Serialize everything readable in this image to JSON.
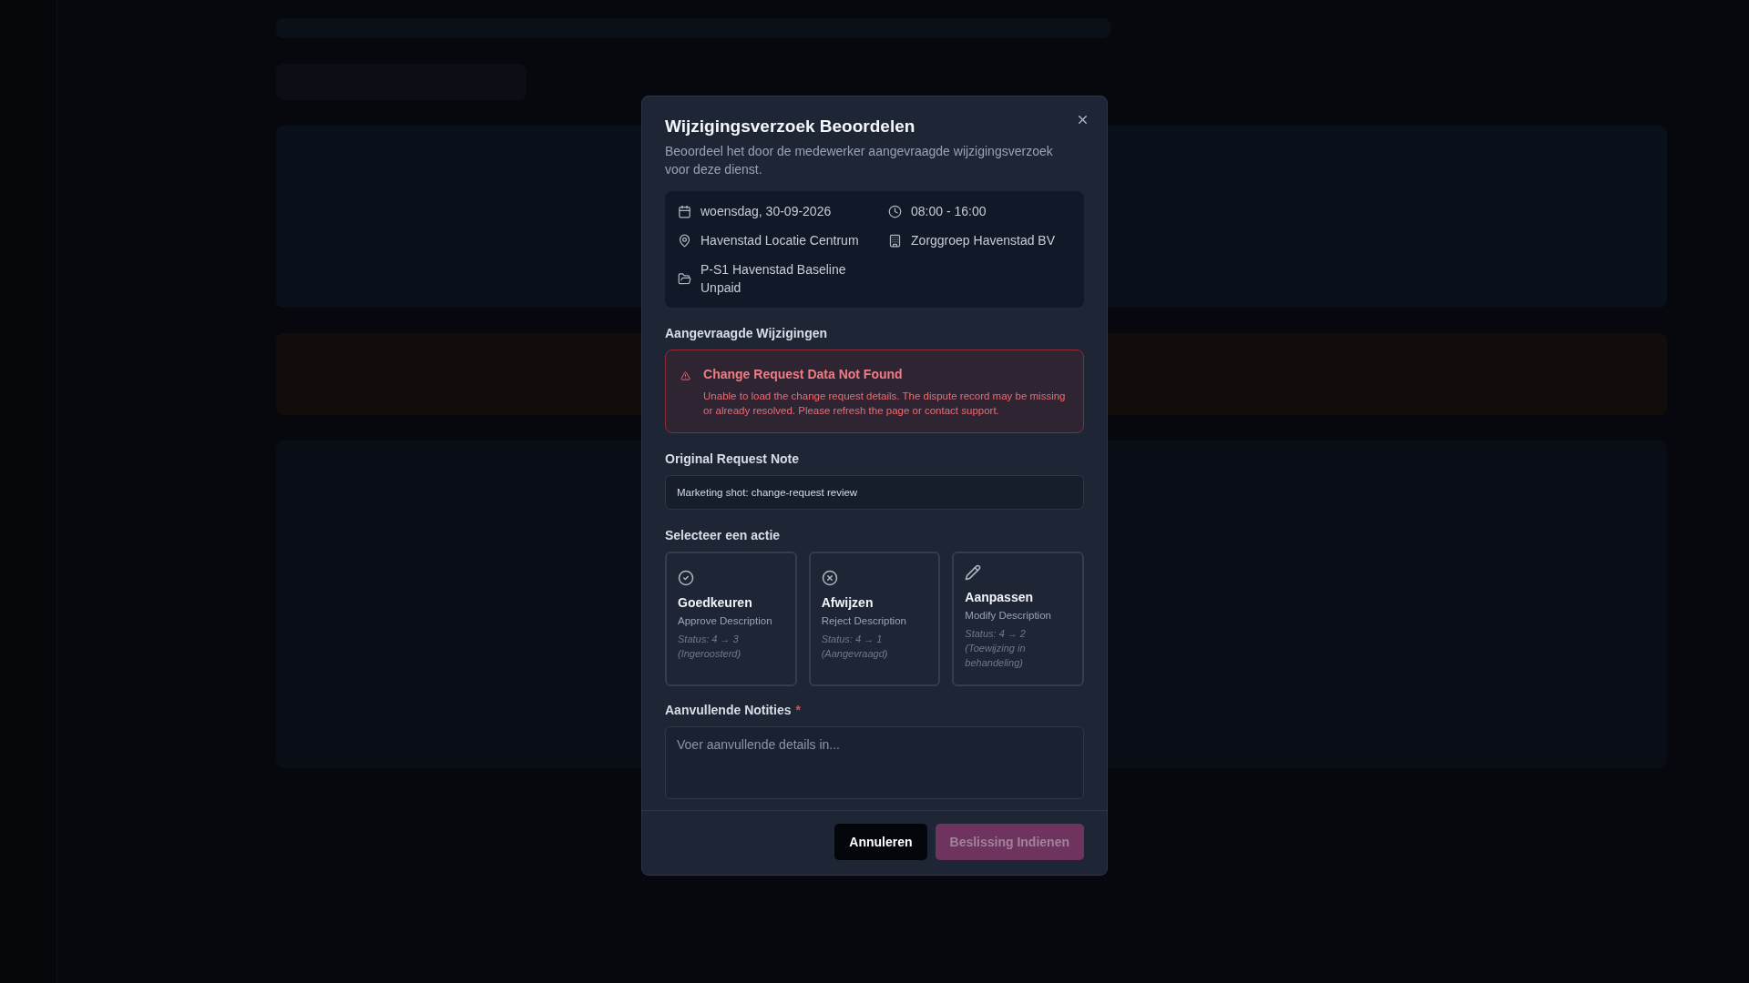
{
  "dialog": {
    "title": "Wijzigingsverzoek Beoordelen",
    "description": "Beoordeel het door de medewerker aangevraagde wijzigingsverzoek voor deze dienst.",
    "details": [
      {
        "kind": "date",
        "text": "woensdag, 30-09-2026"
      },
      {
        "kind": "time",
        "text": "08:00 - 16:00"
      },
      {
        "kind": "location",
        "text": "Havenstad Locatie Centrum"
      },
      {
        "kind": "organization",
        "text": "Zorggroep Havenstad BV"
      },
      {
        "kind": "project",
        "text": "P-S1 Havenstad Baseline Unpaid"
      }
    ],
    "changes_heading": "Aangevraagde Wijzigingen",
    "error": {
      "title": "Change Request Data Not Found",
      "message": "Unable to load the change request details. The dispute record may be missing or already resolved. Please refresh the page or contact support."
    },
    "note": {
      "label": "Original Request Note",
      "value": "Marketing shot: change-request review"
    },
    "actions_heading": "Selecteer een actie",
    "actions": [
      {
        "kind": "approve",
        "title": "Goedkeuren",
        "description": "Approve Description",
        "status": "Status: 4 → 3 (Ingeroosterd)",
        "selected": false
      },
      {
        "kind": "reject",
        "title": "Afwijzen",
        "description": "Reject Description",
        "status": "Status: 4 → 1 (Aangevraagd)",
        "selected": false
      },
      {
        "kind": "modify",
        "title": "Aanpassen",
        "description": "Modify Description",
        "status": "Status: 4 → 2 (Toewijzing in behandeling)",
        "selected": false
      }
    ],
    "notes_field": {
      "label": "Aanvullende Notities",
      "required_mark": "*",
      "placeholder": "Voer aanvullende details in..."
    },
    "buttons": [
      {
        "kind": "cancel",
        "label": "Annuleren",
        "disabled": false
      },
      {
        "kind": "submit",
        "label": "Beslissing Indienen",
        "disabled": true
      }
    ]
  }
}
